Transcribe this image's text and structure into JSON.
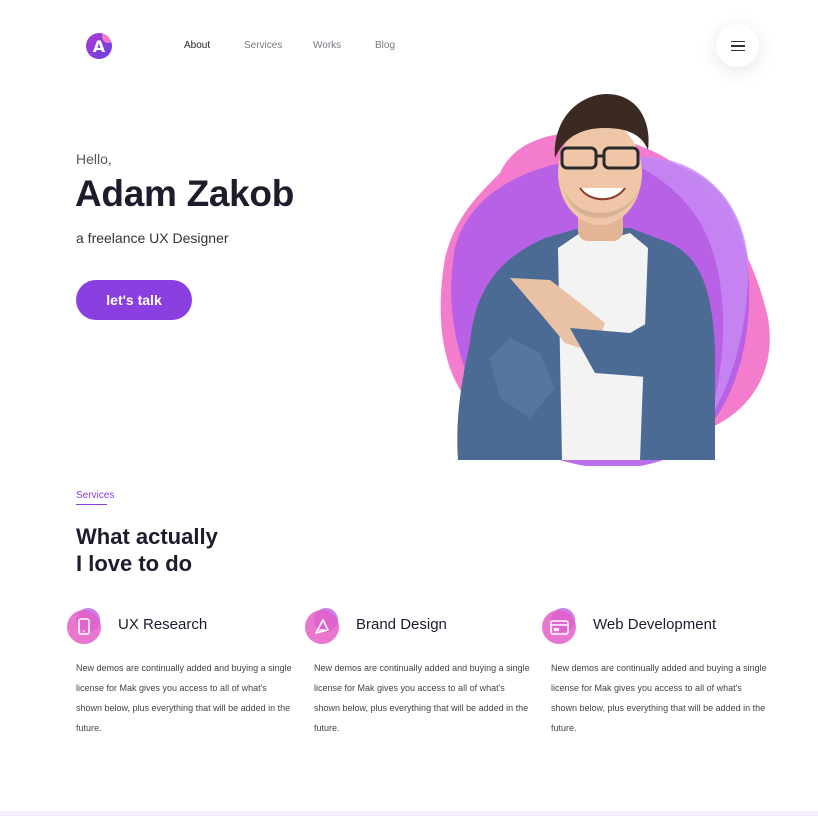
{
  "brand": {
    "logo_letter": "A"
  },
  "nav": {
    "items": [
      {
        "label": "About",
        "active": true
      },
      {
        "label": "Services",
        "active": false
      },
      {
        "label": "Works",
        "active": false
      },
      {
        "label": "Blog",
        "active": false
      }
    ],
    "menu_icon": "hamburger-icon"
  },
  "hero": {
    "greeting": "Hello,",
    "name": "Adam Zakob",
    "role": "a freelance UX Designer",
    "cta_label": "let's talk",
    "image": "portrait-photo"
  },
  "services": {
    "label": "Services",
    "title_line1": "What actually",
    "title_line2": "I love to do",
    "cards": [
      {
        "title": "UX Research",
        "icon": "mobile-phone-icon",
        "description": "New demos are continually added and buying a single license for Mak gives you access to all of what's shown below, plus everything that will be added in the future."
      },
      {
        "title": "Brand Design",
        "icon": "brand-pen-icon",
        "description": "New demos are continually added and buying a single license for Mak gives you access to all of what's shown below, plus everything that will be added in the future."
      },
      {
        "title": "Web Development",
        "icon": "browser-window-icon",
        "description": "New demos are continually added and buying a single license for Mak gives you access to all of what's shown below, plus everything that will be added in the future."
      }
    ]
  },
  "colors": {
    "accent": "#8a3fe0",
    "pink": "#f070c4",
    "violet": "#b65ae8",
    "heading": "#1e1b2c"
  }
}
